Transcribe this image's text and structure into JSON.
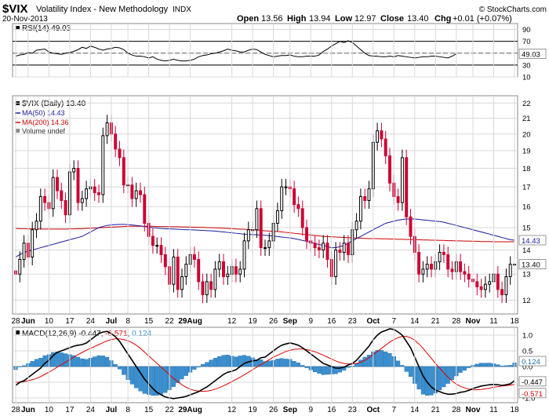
{
  "header": {
    "symbol": "$VIX",
    "name": "Volatility Index - New Methodology",
    "exchange": "INDX",
    "date": "20-Nov-2013",
    "copyright": "© StockCharts.com",
    "open_label": "Open",
    "open": "13.56",
    "high_label": "High",
    "high": "13.94",
    "low_label": "Low",
    "low": "12.97",
    "close_label": "Close",
    "close": "13.40",
    "chg_label": "Chg",
    "chg": "+0.01 (+0.07%)"
  },
  "colors": {
    "up": "#000000",
    "down": "#cc0033",
    "ma50": "#1a1aa0",
    "ma200": "#cc0000",
    "macd_line": "#000000",
    "signal_line": "#e00000",
    "histogram": "#3a8fd0",
    "grid": "#d8d8d8"
  },
  "chart_data": [
    {
      "type": "line",
      "panel": "RSI",
      "label": "RSI(14) 49.03",
      "ylim": [
        10,
        100
      ],
      "ticks": [
        "90",
        "70",
        "50",
        "30",
        "10"
      ],
      "levels": [
        70,
        30
      ],
      "last_value_label": "49.03",
      "values": [
        45,
        47,
        48,
        51,
        50,
        55,
        56,
        57,
        52,
        50,
        49,
        48,
        50,
        51,
        53,
        56,
        60,
        58,
        62,
        60,
        57,
        55,
        57,
        58,
        60,
        59,
        56,
        50,
        47,
        45,
        45,
        44,
        42,
        44,
        40,
        38,
        37,
        38,
        40,
        38,
        37,
        37,
        38,
        40,
        44,
        46,
        47,
        49,
        50,
        52,
        54,
        57,
        55,
        54,
        52,
        52,
        55,
        57,
        56,
        52,
        48,
        46,
        44,
        45,
        46,
        46,
        47,
        45,
        44,
        44,
        45,
        45,
        45,
        47,
        53,
        57,
        62,
        66,
        70,
        68,
        71,
        68,
        62,
        56,
        50,
        46,
        45,
        45,
        44,
        44,
        45,
        44,
        46,
        45,
        44,
        43,
        42,
        43,
        44,
        44,
        45,
        45,
        44,
        43,
        42,
        45,
        49
      ]
    },
    {
      "type": "candlestick",
      "panel": "price",
      "legend": [
        "$VIX (Daily) 13.40",
        "MA(50) 14.43",
        "MA(200) 14.36",
        "Volume undef"
      ],
      "yscale": "log",
      "ylim": [
        11.5,
        22.5
      ],
      "ticks": [
        "22",
        "21",
        "20",
        "19",
        "18",
        "17",
        "16",
        "15",
        "14",
        "13",
        "12"
      ],
      "price_tags": {
        "ma": "14.43",
        "close": "13.40"
      },
      "x_labels": [
        "28",
        "Jun",
        "10",
        "17",
        "24",
        "Jul",
        "8",
        "15",
        "22",
        "29Aug",
        "12",
        "19",
        "26",
        "Sep",
        "9",
        "16",
        "23",
        "Oct",
        "7",
        "14",
        "21",
        "28",
        "Nov",
        "11",
        "18"
      ],
      "x_label_days": [
        0,
        3,
        8,
        13,
        18,
        23,
        27,
        32,
        37,
        42,
        52,
        57,
        62,
        66,
        71,
        76,
        81,
        86,
        91,
        96,
        101,
        106,
        110,
        115,
        120
      ],
      "closes": [
        13.0,
        13.6,
        14.3,
        13.7,
        14.9,
        15.3,
        16.5,
        16.2,
        15.9,
        17.5,
        16.8,
        16.3,
        15.6,
        17.8,
        18.0,
        16.2,
        16.4,
        16.9,
        17.0,
        16.7,
        16.6,
        19.9,
        20.7,
        20.0,
        19.1,
        18.6,
        17.1,
        17.1,
        16.4,
        16.8,
        16.6,
        15.2,
        14.6,
        14.2,
        14.2,
        13.8,
        13.3,
        12.6,
        13.7,
        12.4,
        12.9,
        13.4,
        13.8,
        13.6,
        12.7,
        12.2,
        12.7,
        12.4,
        13.2,
        13.5,
        12.9,
        13.0,
        13.3,
        13.0,
        13.2,
        14.4,
        14.9,
        14.9,
        15.9,
        14.1,
        14.1,
        14.4,
        15.2,
        15.8,
        17.0,
        17.0,
        16.9,
        16.1,
        15.9,
        15.0,
        14.4,
        14.3,
        14.1,
        14.0,
        14.3,
        13.6,
        12.9,
        14.0,
        13.9,
        14.3,
        13.8,
        14.9,
        15.3,
        16.5,
        16.3,
        16.9,
        19.5,
        20.2,
        19.7,
        18.7,
        17.2,
        16.5,
        16.2,
        18.6,
        15.5,
        14.6,
        13.9,
        13.0,
        13.2,
        13.4,
        13.2,
        13.5,
        13.9,
        13.8,
        13.2,
        13.1,
        13.5,
        13.1,
        13.0,
        12.8,
        12.7,
        12.5,
        12.4,
        12.6,
        12.7,
        13.0,
        12.4,
        12.2,
        12.9,
        13.4,
        13.4
      ],
      "ma50": [
        13.7,
        13.8,
        13.9,
        13.95,
        14.0,
        14.05,
        14.1,
        14.15,
        14.2,
        14.25,
        14.3,
        14.35,
        14.4,
        14.45,
        14.5,
        14.55,
        14.6,
        14.7,
        14.8,
        14.9,
        15.0,
        15.05,
        15.1,
        15.12,
        15.14,
        15.15,
        15.15,
        15.14,
        15.12,
        15.1,
        15.08,
        15.05,
        15.02,
        15.0,
        14.98,
        14.96,
        14.95,
        14.94,
        14.93,
        14.92,
        14.91,
        14.9,
        14.9,
        14.89,
        14.88,
        14.87,
        14.86,
        14.85,
        14.84,
        14.82,
        14.8,
        14.78,
        14.76,
        14.74,
        14.72,
        14.7,
        14.69,
        14.68,
        14.67,
        14.66,
        14.65,
        14.63,
        14.61,
        14.59,
        14.57,
        14.55,
        14.53,
        14.5,
        14.46,
        14.42,
        14.38,
        14.33,
        14.28,
        14.24,
        14.2,
        14.15,
        14.1,
        14.1,
        14.15,
        14.2,
        14.3,
        14.4,
        14.5,
        14.6,
        14.7,
        14.8,
        14.9,
        15.0,
        15.1,
        15.2,
        15.25,
        15.3,
        15.35,
        15.38,
        15.4,
        15.4,
        15.4,
        15.38,
        15.36,
        15.34,
        15.32,
        15.3,
        15.28,
        15.25,
        15.2,
        15.15,
        15.1,
        15.05,
        15.0,
        14.95,
        14.9,
        14.85,
        14.8,
        14.75,
        14.7,
        14.65,
        14.6,
        14.55,
        14.5,
        14.45,
        14.43
      ],
      "ma200": [
        14.96,
        14.95,
        14.95,
        14.94,
        14.94,
        14.94,
        14.93,
        14.93,
        14.93,
        14.93,
        14.93,
        14.93,
        14.93,
        14.94,
        14.94,
        14.95,
        14.95,
        14.96,
        14.97,
        14.98,
        14.99,
        15.0,
        15.01,
        15.02,
        15.03,
        15.04,
        15.05,
        15.06,
        15.06,
        15.06,
        15.06,
        15.06,
        15.06,
        15.06,
        15.05,
        15.05,
        15.05,
        15.04,
        15.04,
        15.04,
        15.03,
        15.03,
        15.02,
        15.02,
        15.01,
        15.01,
        15.0,
        15.0,
        14.99,
        14.98,
        14.97,
        14.96,
        14.95,
        14.94,
        14.93,
        14.92,
        14.91,
        14.9,
        14.89,
        14.87,
        14.85,
        14.84,
        14.83,
        14.82,
        14.8,
        14.78,
        14.76,
        14.74,
        14.72,
        14.7,
        14.68,
        14.66,
        14.64,
        14.62,
        14.6,
        14.59,
        14.58,
        14.57,
        14.56,
        14.55,
        14.54,
        14.53,
        14.52,
        14.52,
        14.51,
        14.5,
        14.5,
        14.5,
        14.49,
        14.49,
        14.48,
        14.48,
        14.47,
        14.47,
        14.46,
        14.46,
        14.45,
        14.45,
        14.44,
        14.44,
        14.43,
        14.43,
        14.42,
        14.42,
        14.41,
        14.41,
        14.4,
        14.4,
        14.39,
        14.39,
        14.38,
        14.38,
        14.37,
        14.37,
        14.37,
        14.36,
        14.36,
        14.36,
        14.36,
        14.36,
        14.36
      ]
    },
    {
      "type": "line",
      "panel": "MACD",
      "label_prefix": "MACD(12,26,9)",
      "label_macd": "-0.447",
      "label_signal": "-0.571",
      "label_hist": "0.124",
      "ylim": [
        -1.15,
        1.25
      ],
      "ticks": [
        "1.0",
        "0.5",
        "0.0",
        "-0.5",
        "-1.0"
      ],
      "value_tags": {
        "hist": "0.124",
        "macd": "-0.447",
        "signal": "-0.571"
      },
      "macd": [
        -0.6,
        -0.5,
        -0.45,
        -0.35,
        -0.25,
        -0.15,
        -0.05,
        0.1,
        0.2,
        0.35,
        0.45,
        0.5,
        0.55,
        0.6,
        0.65,
        0.68,
        0.7,
        0.75,
        0.85,
        0.95,
        1.05,
        1.1,
        1.12,
        1.05,
        0.95,
        0.8,
        0.6,
        0.4,
        0.2,
        0.0,
        -0.2,
        -0.4,
        -0.55,
        -0.7,
        -0.82,
        -0.9,
        -0.97,
        -1.0,
        -1.02,
        -1.0,
        -0.98,
        -0.95,
        -0.9,
        -0.85,
        -0.8,
        -0.72,
        -0.65,
        -0.55,
        -0.45,
        -0.35,
        -0.25,
        -0.18,
        -0.15,
        -0.1,
        0.0,
        0.1,
        0.15,
        0.18,
        0.2,
        0.28,
        0.3,
        0.4,
        0.5,
        0.6,
        0.68,
        0.72,
        0.75,
        0.72,
        0.68,
        0.6,
        0.5,
        0.4,
        0.3,
        0.2,
        0.1,
        0.05,
        0.0,
        -0.05,
        -0.05,
        -0.02,
        0.05,
        0.1,
        0.2,
        0.35,
        0.5,
        0.65,
        0.85,
        1.0,
        1.1,
        1.15,
        1.2,
        1.18,
        1.1,
        1.0,
        0.8,
        0.6,
        0.3,
        0.0,
        -0.3,
        -0.5,
        -0.65,
        -0.75,
        -0.8,
        -0.85,
        -0.88,
        -0.88,
        -0.86,
        -0.82,
        -0.8,
        -0.76,
        -0.7,
        -0.66,
        -0.62,
        -0.6,
        -0.58,
        -0.57,
        -0.58,
        -0.6,
        -0.58,
        -0.55,
        -0.45
      ],
      "signal": [
        -0.5,
        -0.5,
        -0.48,
        -0.45,
        -0.42,
        -0.38,
        -0.32,
        -0.25,
        -0.18,
        -0.1,
        -0.02,
        0.06,
        0.14,
        0.22,
        0.3,
        0.38,
        0.45,
        0.52,
        0.58,
        0.64,
        0.7,
        0.76,
        0.82,
        0.86,
        0.88,
        0.88,
        0.86,
        0.82,
        0.76,
        0.68,
        0.58,
        0.46,
        0.34,
        0.22,
        0.1,
        -0.02,
        -0.14,
        -0.26,
        -0.38,
        -0.48,
        -0.58,
        -0.66,
        -0.72,
        -0.76,
        -0.78,
        -0.79,
        -0.78,
        -0.76,
        -0.72,
        -0.67,
        -0.61,
        -0.55,
        -0.48,
        -0.41,
        -0.34,
        -0.26,
        -0.18,
        -0.1,
        -0.02,
        0.06,
        0.14,
        0.22,
        0.3,
        0.36,
        0.42,
        0.48,
        0.52,
        0.55,
        0.56,
        0.56,
        0.54,
        0.51,
        0.47,
        0.42,
        0.36,
        0.3,
        0.24,
        0.18,
        0.13,
        0.1,
        0.08,
        0.08,
        0.1,
        0.14,
        0.2,
        0.28,
        0.38,
        0.48,
        0.58,
        0.68,
        0.78,
        0.86,
        0.92,
        0.96,
        0.96,
        0.92,
        0.84,
        0.72,
        0.58,
        0.42,
        0.26,
        0.1,
        -0.05,
        -0.2,
        -0.34,
        -0.46,
        -0.56,
        -0.63,
        -0.68,
        -0.72,
        -0.74,
        -0.74,
        -0.73,
        -0.71,
        -0.69,
        -0.66,
        -0.64,
        -0.62,
        -0.61,
        -0.59,
        -0.57
      ]
    }
  ]
}
